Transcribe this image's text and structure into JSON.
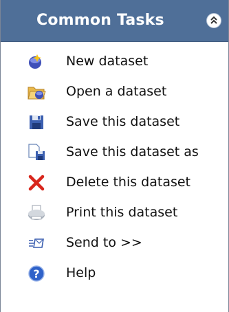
{
  "header": {
    "title": "Common Tasks",
    "collapse_icon": "chevron-double-up-icon"
  },
  "tasks": [
    {
      "label": "New dataset",
      "icon": "new-dataset-icon"
    },
    {
      "label": "Open a dataset",
      "icon": "open-folder-icon"
    },
    {
      "label": "Save this dataset",
      "icon": "floppy-disk-icon"
    },
    {
      "label": "Save this dataset as",
      "icon": "save-as-icon"
    },
    {
      "label": "Delete this dataset",
      "icon": "delete-x-icon"
    },
    {
      "label": "Print this dataset",
      "icon": "printer-icon"
    },
    {
      "label": "Send to >>",
      "icon": "send-to-icon"
    },
    {
      "label": "Help",
      "icon": "help-icon"
    }
  ],
  "colors": {
    "header_bg": "#4f6f98",
    "delete_red": "#d8261c"
  }
}
